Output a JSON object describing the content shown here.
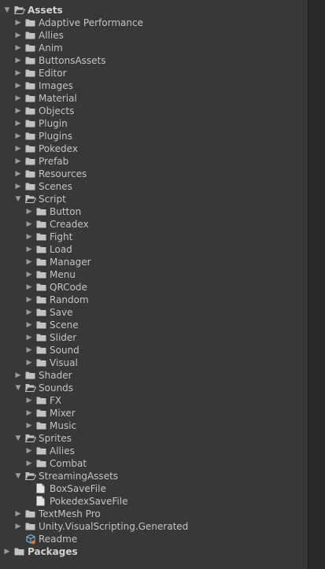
{
  "project_tree": [
    {
      "label": "Assets",
      "depth": 0,
      "type": "folder",
      "expanded": true,
      "bold": true,
      "icon": "folder-open-icon"
    },
    {
      "label": "Adaptive Performance",
      "depth": 1,
      "type": "folder",
      "expanded": false,
      "icon": "folder-icon"
    },
    {
      "label": "Allies",
      "depth": 1,
      "type": "folder",
      "expanded": false,
      "icon": "folder-icon"
    },
    {
      "label": "Anim",
      "depth": 1,
      "type": "folder",
      "expanded": false,
      "icon": "folder-icon"
    },
    {
      "label": "ButtonsAssets",
      "depth": 1,
      "type": "folder",
      "expanded": false,
      "icon": "folder-icon"
    },
    {
      "label": "Editor",
      "depth": 1,
      "type": "folder",
      "expanded": false,
      "icon": "folder-icon"
    },
    {
      "label": "Images",
      "depth": 1,
      "type": "folder",
      "expanded": false,
      "icon": "folder-icon"
    },
    {
      "label": "Material",
      "depth": 1,
      "type": "folder",
      "expanded": false,
      "icon": "folder-icon"
    },
    {
      "label": "Objects",
      "depth": 1,
      "type": "folder",
      "expanded": false,
      "icon": "folder-icon"
    },
    {
      "label": "Plugin",
      "depth": 1,
      "type": "folder",
      "expanded": false,
      "icon": "folder-icon"
    },
    {
      "label": "Plugins",
      "depth": 1,
      "type": "folder",
      "expanded": false,
      "icon": "folder-icon"
    },
    {
      "label": "Pokedex",
      "depth": 1,
      "type": "folder",
      "expanded": false,
      "icon": "folder-icon"
    },
    {
      "label": "Prefab",
      "depth": 1,
      "type": "folder",
      "expanded": false,
      "icon": "folder-icon"
    },
    {
      "label": "Resources",
      "depth": 1,
      "type": "folder",
      "expanded": false,
      "icon": "folder-icon"
    },
    {
      "label": "Scenes",
      "depth": 1,
      "type": "folder",
      "expanded": false,
      "icon": "folder-icon"
    },
    {
      "label": "Script",
      "depth": 1,
      "type": "folder",
      "expanded": true,
      "icon": "folder-open-icon"
    },
    {
      "label": "Button",
      "depth": 2,
      "type": "folder",
      "expanded": false,
      "icon": "folder-icon"
    },
    {
      "label": "Creadex",
      "depth": 2,
      "type": "folder",
      "expanded": false,
      "icon": "folder-icon"
    },
    {
      "label": "Fight",
      "depth": 2,
      "type": "folder",
      "expanded": false,
      "icon": "folder-icon"
    },
    {
      "label": "Load",
      "depth": 2,
      "type": "folder",
      "expanded": false,
      "icon": "folder-icon"
    },
    {
      "label": "Manager",
      "depth": 2,
      "type": "folder",
      "expanded": false,
      "icon": "folder-icon"
    },
    {
      "label": "Menu",
      "depth": 2,
      "type": "folder",
      "expanded": false,
      "icon": "folder-icon"
    },
    {
      "label": "QRCode",
      "depth": 2,
      "type": "folder",
      "expanded": false,
      "icon": "folder-icon"
    },
    {
      "label": "Random",
      "depth": 2,
      "type": "folder",
      "expanded": false,
      "icon": "folder-icon"
    },
    {
      "label": "Save",
      "depth": 2,
      "type": "folder",
      "expanded": false,
      "icon": "folder-icon"
    },
    {
      "label": "Scene",
      "depth": 2,
      "type": "folder",
      "expanded": false,
      "icon": "folder-icon"
    },
    {
      "label": "Slider",
      "depth": 2,
      "type": "folder",
      "expanded": false,
      "icon": "folder-icon"
    },
    {
      "label": "Sound",
      "depth": 2,
      "type": "folder",
      "expanded": false,
      "icon": "folder-icon"
    },
    {
      "label": "Visual",
      "depth": 2,
      "type": "folder",
      "expanded": false,
      "icon": "folder-icon"
    },
    {
      "label": "Shader",
      "depth": 1,
      "type": "folder",
      "expanded": false,
      "icon": "folder-icon"
    },
    {
      "label": "Sounds",
      "depth": 1,
      "type": "folder",
      "expanded": true,
      "icon": "folder-open-icon"
    },
    {
      "label": "FX",
      "depth": 2,
      "type": "folder",
      "expanded": false,
      "icon": "folder-icon"
    },
    {
      "label": "Mixer",
      "depth": 2,
      "type": "folder",
      "expanded": false,
      "icon": "folder-icon"
    },
    {
      "label": "Music",
      "depth": 2,
      "type": "folder",
      "expanded": false,
      "icon": "folder-icon"
    },
    {
      "label": "Sprites",
      "depth": 1,
      "type": "folder",
      "expanded": true,
      "icon": "folder-open-icon"
    },
    {
      "label": "Allies",
      "depth": 2,
      "type": "folder",
      "expanded": false,
      "icon": "folder-icon"
    },
    {
      "label": "Combat",
      "depth": 2,
      "type": "folder",
      "expanded": false,
      "icon": "folder-icon"
    },
    {
      "label": "StreamingAssets",
      "depth": 1,
      "type": "folder",
      "expanded": true,
      "icon": "folder-open-icon"
    },
    {
      "label": "BoxSaveFile",
      "depth": 2,
      "type": "file",
      "icon": "file-icon"
    },
    {
      "label": "PokedexSaveFile",
      "depth": 2,
      "type": "file",
      "icon": "file-icon"
    },
    {
      "label": "TextMesh Pro",
      "depth": 1,
      "type": "folder",
      "expanded": false,
      "icon": "folder-icon"
    },
    {
      "label": "Unity.VisualScripting.Generated",
      "depth": 1,
      "type": "folder",
      "expanded": false,
      "icon": "folder-icon"
    },
    {
      "label": "Readme",
      "depth": 1,
      "type": "asset",
      "icon": "readme-asset-icon"
    },
    {
      "label": "Packages",
      "depth": 0,
      "type": "folder",
      "expanded": false,
      "bold": true,
      "icon": "folder-icon"
    }
  ],
  "colors": {
    "panel_bg": "#383838",
    "empty_bg": "#282828",
    "text": "#c4c4c4",
    "folder": "#c2c2c2",
    "readme_accent": "#e0783c"
  }
}
